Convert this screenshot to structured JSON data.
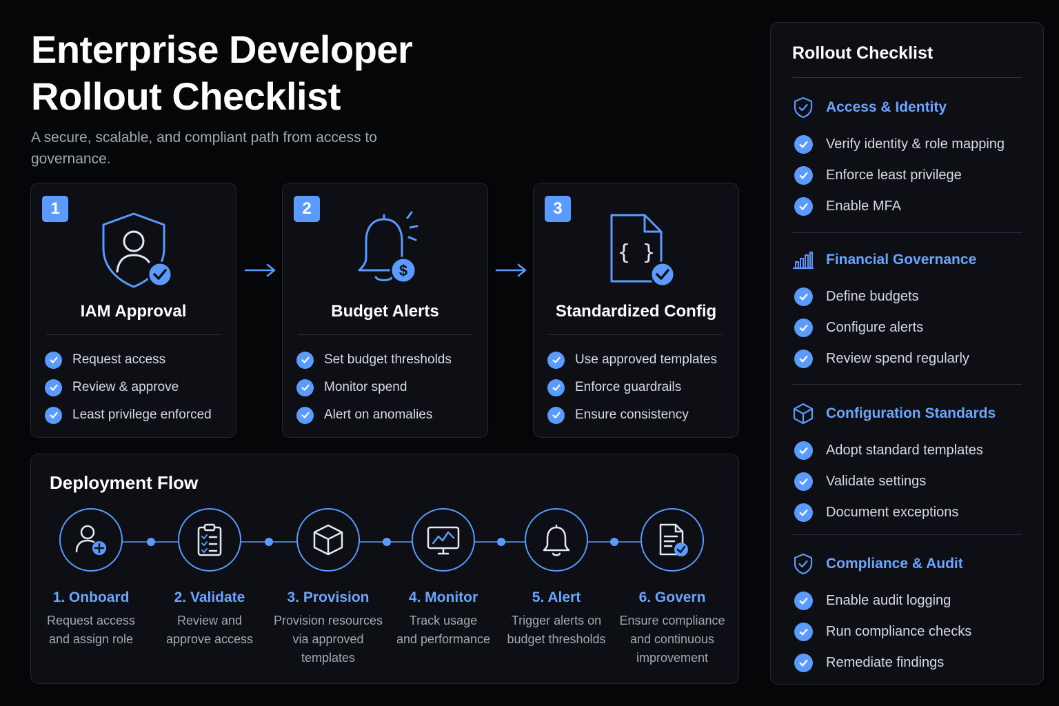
{
  "header": {
    "title_line1": "Enterprise Developer",
    "title_line2": "Rollout Checklist",
    "subtitle": "A secure, scalable, and compliant path from access to governance."
  },
  "colors": {
    "accent": "#5b9bff",
    "background": "#050608",
    "card": "#0d0f14",
    "muted_text": "#a3a8b3"
  },
  "cards": [
    {
      "number": "1",
      "icon": "shield-user-check-icon",
      "title": "IAM Approval",
      "items": [
        "Request access",
        "Review & approve",
        "Least privilege enforced"
      ]
    },
    {
      "number": "2",
      "icon": "bell-dollar-icon",
      "title": "Budget Alerts",
      "items": [
        "Set budget thresholds",
        "Monitor spend",
        "Alert on anomalies"
      ]
    },
    {
      "number": "3",
      "icon": "code-file-check-icon",
      "title": "Standardized Config",
      "items": [
        "Use approved templates",
        "Enforce guardrails",
        "Ensure consistency"
      ]
    }
  ],
  "flow": {
    "title": "Deployment Flow",
    "steps": [
      {
        "label": "1. Onboard",
        "desc1": "Request access",
        "desc2": "and assign role",
        "desc3": "",
        "icon": "user-plus-icon"
      },
      {
        "label": "2. Validate",
        "desc1": "Review and",
        "desc2": "approve access",
        "desc3": "",
        "icon": "clipboard-check-icon"
      },
      {
        "label": "3. Provision",
        "desc1": "Provision resources",
        "desc2": "via approved",
        "desc3": "templates",
        "icon": "cube-icon"
      },
      {
        "label": "4. Monitor",
        "desc1": "Track usage",
        "desc2": "and performance",
        "desc3": "",
        "icon": "monitor-chart-icon"
      },
      {
        "label": "5. Alert",
        "desc1": "Trigger alerts on",
        "desc2": "budget thresholds",
        "desc3": "",
        "icon": "bell-icon"
      },
      {
        "label": "6. Govern",
        "desc1": "Ensure compliance",
        "desc2": "and continuous",
        "desc3": "improvement",
        "icon": "document-check-icon"
      }
    ]
  },
  "panel": {
    "title": "Rollout Checklist",
    "sections": [
      {
        "title": "Access & Identity",
        "icon": "shield-check-icon",
        "items": [
          "Verify identity & role mapping",
          "Enforce least privilege",
          "Enable MFA"
        ]
      },
      {
        "title": "Financial Governance",
        "icon": "bar-chart-icon",
        "items": [
          "Define budgets",
          "Configure alerts",
          "Review spend regularly"
        ]
      },
      {
        "title": "Configuration Standards",
        "icon": "cube-icon",
        "items": [
          "Adopt standard templates",
          "Validate settings",
          "Document exceptions"
        ]
      },
      {
        "title": "Compliance & Audit",
        "icon": "shield-check-icon",
        "items": [
          "Enable audit logging",
          "Run compliance checks",
          "Remediate findings"
        ]
      }
    ]
  }
}
